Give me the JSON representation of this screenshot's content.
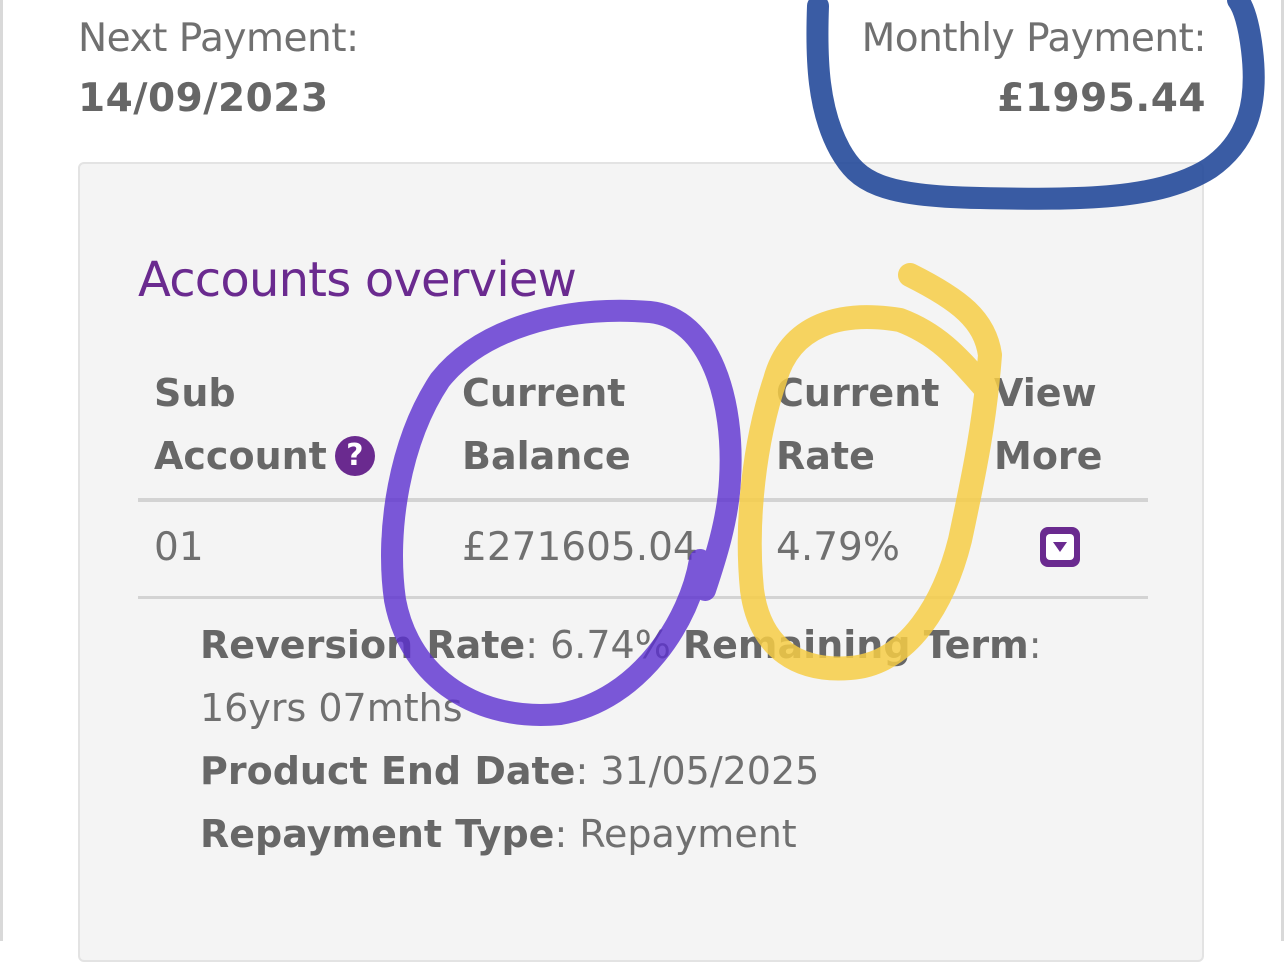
{
  "next_payment": {
    "label": "Next Payment:",
    "value": "14/09/2023"
  },
  "monthly_payment": {
    "label": "Monthly Payment:",
    "value": "£1995.44"
  },
  "accounts": {
    "title": "Accounts overview",
    "headers": {
      "sub_line1": "Sub",
      "sub_line2": "Account",
      "balance_line1": "Current",
      "balance_line2": "Balance",
      "rate_line1": "Current",
      "rate_line2": "Rate",
      "more_line1": "View",
      "more_line2": "More"
    },
    "help_icon": "?",
    "rows": [
      {
        "sub": "01",
        "balance": "£271605.04",
        "rate": "4.79%"
      }
    ],
    "details": {
      "reversion_label": "Reversion Rate",
      "reversion_value": ": 6.74% ",
      "term_label": "Remaining Term",
      "term_value": ": 16yrs 07mths",
      "end_label": "Product End Date",
      "end_value": ": 31/05/2025",
      "repay_label": "Repayment Type",
      "repay_value": ": Repayment"
    }
  },
  "colors": {
    "brand_purple": "#6a2a8f",
    "annotation_blue": "#1f4597",
    "annotation_purple": "#5b2fd0",
    "annotation_yellow": "#f6cd45"
  },
  "icons": [
    "question-circle-icon",
    "chevron-down-icon"
  ]
}
